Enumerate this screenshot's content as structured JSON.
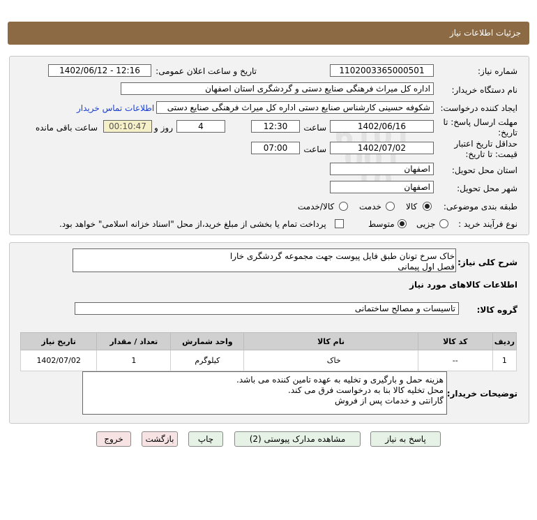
{
  "page_title": "جزئیات اطلاعات نیاز",
  "need_number": {
    "label": "شماره نیاز:",
    "value": "1102003365000501"
  },
  "announce_datetime": {
    "label": "تاریخ و ساعت اعلان عمومی:",
    "value": "1402/06/12 - 12:16"
  },
  "buyer_org": {
    "label": "نام دستگاه خریدار:",
    "value": "اداره کل میراث فرهنگی  صنایع دستی و گردشگری استان اصفهان"
  },
  "requester": {
    "label": "ایجاد کننده درخواست:",
    "value": "شکوفه حسینی کارشناس صنایع دستی اداره کل میراث فرهنگی  صنایع دستی",
    "contact_link": "اطلاعات تماس خریدار"
  },
  "deadline": {
    "label": "مهلت ارسال پاسخ: تا تاریخ:",
    "date": "1402/06/16",
    "time_label": "ساعت",
    "time": "12:30",
    "days": "4",
    "days_label": "روز و",
    "remaining": "00:10:47",
    "remaining_label": "ساعت باقی مانده"
  },
  "validity": {
    "label": "حداقل تاریخ اعتبار قیمت: تا تاریخ:",
    "date": "1402/07/02",
    "time_label": "ساعت",
    "time": "07:00"
  },
  "delivery_province": {
    "label": "استان محل تحویل:",
    "value": "اصفهان"
  },
  "delivery_city": {
    "label": "شهر محل تحویل:",
    "value": "اصفهان"
  },
  "category": {
    "label": "طبقه بندی موضوعی:",
    "options": [
      "کالا",
      "خدمت",
      "کالا/خدمت"
    ],
    "selected": "کالا"
  },
  "purchase_type": {
    "label": "نوع فرآیند خرید :",
    "options": [
      "جزیی",
      "متوسط"
    ],
    "selected": "متوسط",
    "payment_note": "پرداخت تمام یا بخشی از مبلغ خرید،از محل \"اسناد خزانه اسلامی\" خواهد بود."
  },
  "summary": {
    "label": "شرح کلی نیاز:",
    "line1": "خاک سرخ تونان طبق فایل پیوست جهت مجموعه گردشگری خارا",
    "line2": "فصل اول پیمانی"
  },
  "goods_section_title": "اطلاعات کالاهای مورد نیاز",
  "goods_group": {
    "label": "گروه کالا:",
    "value": "تاسیسات و مصالح ساختمانی"
  },
  "table": {
    "headers": [
      "ردیف",
      "کد کالا",
      "نام کالا",
      "واحد شمارش",
      "تعداد / مقدار",
      "تاریخ نیاز"
    ],
    "rows": [
      [
        "1",
        "--",
        "خاک",
        "کیلوگرم",
        "1",
        "1402/07/02"
      ]
    ]
  },
  "buyer_notes": {
    "label": "توضیحات خریدار:",
    "line1": "هزینه حمل و بارگیری و تخلیه به عهده تامین کننده می باشد.",
    "line2": "محل تخلیه کالا بنا به درخواست فرق می کند.",
    "line3": "گارانتی و خدمات پس از فروش"
  },
  "buttons": {
    "reply": "پاسخ به نیاز",
    "attachments": "مشاهده مدارک پیوستی (2)",
    "print": "چاپ",
    "back": "بازگشت",
    "exit": "خروج"
  },
  "watermark": {
    "brand": "ParsNamadData",
    "line1": "پایگاه اطلاع رسانی مناقصات و مزایده",
    "phone": "۰۲۱-۸۸۳۴۹۶۷۰-۵",
    "fa_brand": "پارس نماد داده",
    "code": "6101 001 10"
  }
}
